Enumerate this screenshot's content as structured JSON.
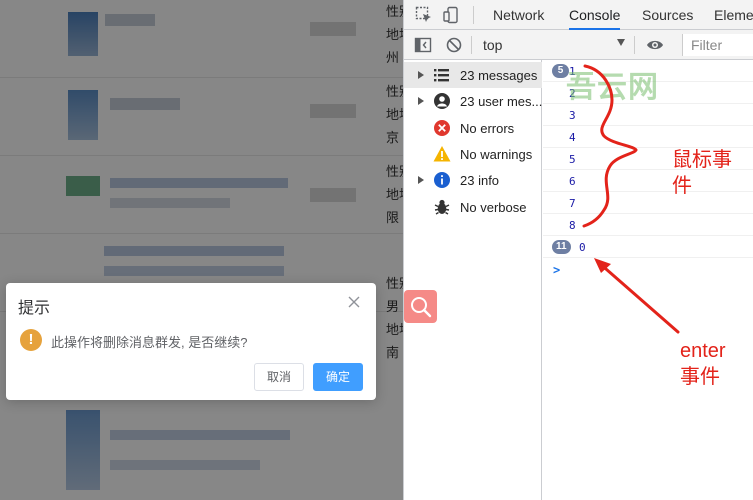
{
  "left_panel": {
    "side_snippets": [
      "性别\n地址\n州",
      "性别\n地址\n京",
      "性别\n地址\n限",
      "性别\n男\n地址\n南"
    ],
    "dialog": {
      "title": "提示",
      "message": "此操作将删除消息群发, 是否继续?",
      "cancel_label": "取消",
      "confirm_label": "确定"
    }
  },
  "devtools": {
    "tabs": [
      "Network",
      "Console",
      "Sources",
      "Elemer"
    ],
    "active_tab": "Console",
    "context": "top",
    "filter_placeholder": "Filter",
    "sidebar": [
      {
        "label": "23 messages",
        "icon": "list-icon",
        "expandable": true,
        "selected": true
      },
      {
        "label": "23 user mes...",
        "icon": "user-icon",
        "expandable": true,
        "selected": false
      },
      {
        "label": "No errors",
        "icon": "error-icon",
        "expandable": false,
        "selected": false
      },
      {
        "label": "No warnings",
        "icon": "warning-icon",
        "expandable": false,
        "selected": false
      },
      {
        "label": "23 info",
        "icon": "info-icon",
        "expandable": true,
        "selected": false
      },
      {
        "label": "No verbose",
        "icon": "bug-icon",
        "expandable": false,
        "selected": false
      }
    ],
    "log": [
      {
        "badge": "5",
        "value": "1"
      },
      {
        "badge": "",
        "value": "2"
      },
      {
        "badge": "",
        "value": "3"
      },
      {
        "badge": "",
        "value": "4"
      },
      {
        "badge": "",
        "value": "5"
      },
      {
        "badge": "",
        "value": "6"
      },
      {
        "badge": "",
        "value": "7"
      },
      {
        "badge": "",
        "value": "8"
      },
      {
        "badge": "11",
        "value": "0"
      }
    ],
    "prompt": ">"
  },
  "annotations": {
    "mouse_event": "鼠标事\n件",
    "enter_event": "enter\n事件",
    "watermark": "吾云网"
  },
  "colors": {
    "accent": "#409eff",
    "warning": "#e6a23c",
    "annotation": "#e3231a",
    "devtools_accent": "#1a73e8"
  }
}
